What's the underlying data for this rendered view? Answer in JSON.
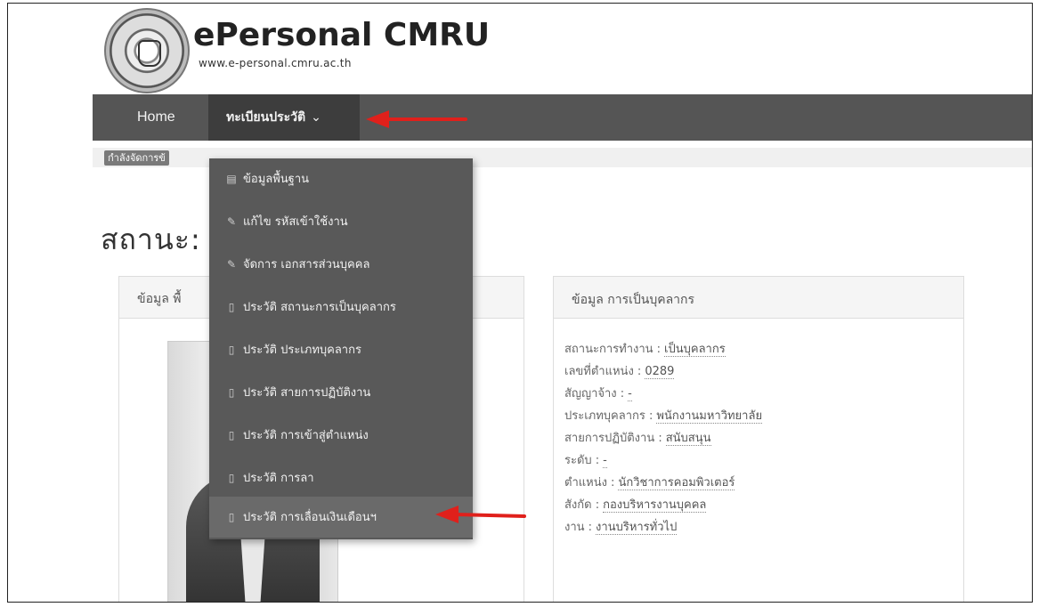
{
  "logo": {
    "title": "ePersonal CMRU",
    "url": "www.e-personal.cmru.ac.th"
  },
  "nav": {
    "home": "Home",
    "registry": "ทะเบียนประวัติ",
    "registry_chevron": "chevron-down-icon"
  },
  "breadcrumb": {
    "label": "กำลังจัดการข้"
  },
  "page": {
    "title": "สถานะ:"
  },
  "left_panel": {
    "title": "ข้อมูล พื้"
  },
  "dropdown": {
    "items": [
      {
        "label": "ข้อมูลพื้นฐาน",
        "icon": "id-card-icon"
      },
      {
        "label": "แก้ไข รหัสเข้าใช้งาน",
        "icon": "edit-icon"
      },
      {
        "label": "จัดการ เอกสารส่วนบุคคล",
        "icon": "edit-icon"
      },
      {
        "label": "ประวัติ สถานะการเป็นบุคลากร",
        "icon": "document-icon"
      },
      {
        "label": "ประวัติ ประเภทบุคลากร",
        "icon": "document-icon"
      },
      {
        "label": "ประวัติ สายการปฏิบัติงาน",
        "icon": "document-icon"
      },
      {
        "label": "ประวัติ การเข้าสู่ตำแหน่ง",
        "icon": "document-icon"
      },
      {
        "label": "ประวัติ การลา",
        "icon": "document-icon"
      },
      {
        "label": "ประวัติ การเลื่อนเงินเดือนฯ",
        "icon": "document-icon"
      }
    ]
  },
  "right_panel": {
    "title": "ข้อมูล การเป็นบุคลากร",
    "rows": [
      {
        "label": "สถานะการทำงาน :",
        "value": "เป็นบุคลากร"
      },
      {
        "label": "เลขที่ตำแหน่ง :",
        "value": "0289"
      },
      {
        "label": "สัญญาจ้าง :",
        "value": "-"
      },
      {
        "label": "ประเภทบุคลากร :",
        "value": "พนักงานมหาวิทยาลัย"
      },
      {
        "label": "สายการปฏิบัติงาน :",
        "value": "สนับสนุน"
      },
      {
        "label": "ระดับ :",
        "value": "-"
      },
      {
        "label": "ตำแหน่ง :",
        "value": "นักวิชาการคอมพิวเตอร์"
      },
      {
        "label": "สังกัด :",
        "value": "กองบริหารงานบุคคล"
      },
      {
        "label": "งาน :",
        "value": "งานบริหารทั่วไป"
      }
    ]
  },
  "colors": {
    "navbar": "#555555",
    "dropdown": "#595959",
    "arrow": "#e0201b"
  }
}
